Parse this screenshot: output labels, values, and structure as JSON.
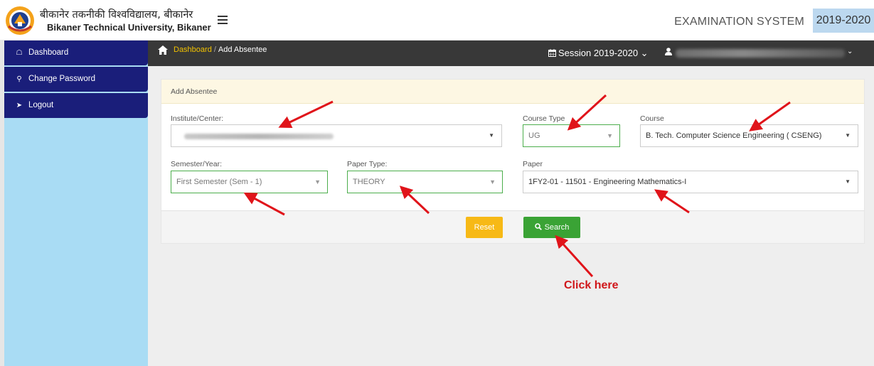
{
  "header": {
    "university_hindi": "बीकानेर तकनीकी विश्वविद्यालय, बीकानेर",
    "university_english": "Bikaner Technical University, Bikaner",
    "system_title": "EXAMINATION SYSTEM",
    "session_badge": "2019-2020"
  },
  "sidebar": {
    "items": [
      {
        "icon": "home-icon",
        "label": "Dashboard"
      },
      {
        "icon": "key-icon",
        "label": "Change Password"
      },
      {
        "icon": "logout-icon",
        "label": "Logout"
      }
    ]
  },
  "breadcrumb": {
    "home": "Dashboard",
    "separator": "/",
    "current": "Add Absentee"
  },
  "topnav": {
    "session_label": "Session",
    "session_value": "2019-2020",
    "caret": "⌄"
  },
  "form": {
    "panel_title": "Add Absentee",
    "institute_label": "Institute/Center:",
    "course_type_label": "Course Type",
    "course_type_value": "UG",
    "course_label": "Course",
    "course_value": "B. Tech. Computer Science Engineering ( CSENG)",
    "semester_label": "Semester/Year:",
    "semester_value": "First Semester (Sem - 1)",
    "paper_type_label": "Paper Type:",
    "paper_type_value": "THEORY",
    "paper_label": "Paper",
    "paper_value": "1FY2-01 - 11501 - Engineering Mathematics-I",
    "reset_label": "Reset",
    "search_label": "Search"
  },
  "annotation": {
    "click_here": "Click here"
  },
  "colors": {
    "sidebar_item": "#1a1e7a",
    "sidebar_bg": "#a9dcf4",
    "breadcrumb_bar": "#383838",
    "breadcrumb_link": "#f2c200",
    "reset_button": "#f7b916",
    "search_button": "#3aa335",
    "annotation_arrow": "#e0141a"
  }
}
